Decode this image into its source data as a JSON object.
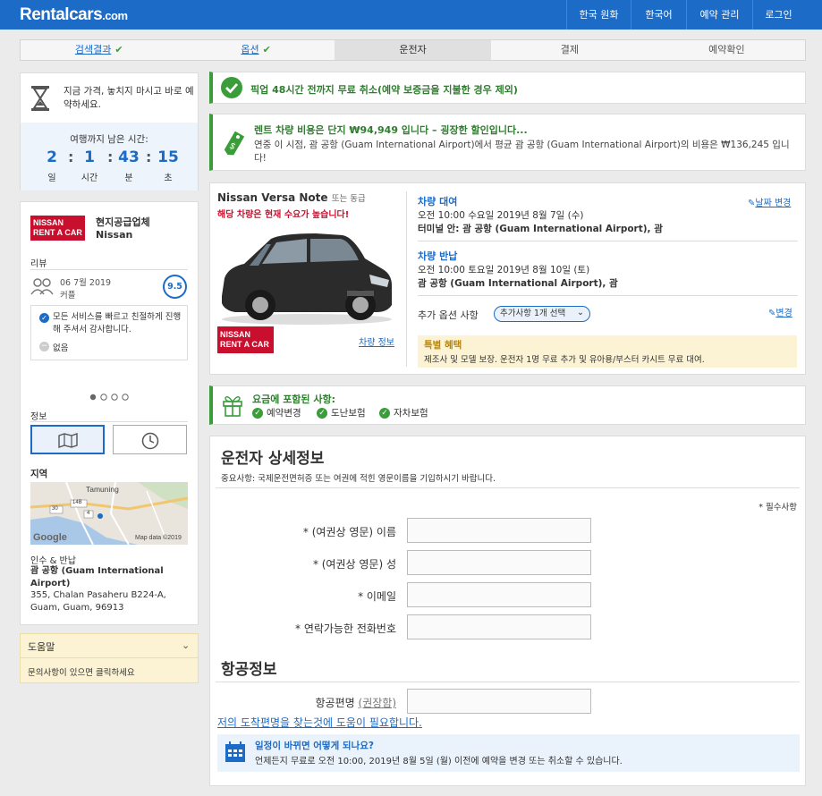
{
  "header": {
    "logo_main": "Rentalcars",
    "logo_suffix": ".com",
    "nav": [
      "한국 원화",
      "한국어",
      "예약 관리",
      "로그인"
    ]
  },
  "steps": [
    {
      "label": "검색결과",
      "state": "done"
    },
    {
      "label": "옵션",
      "state": "done"
    },
    {
      "label": "운전자",
      "state": "active"
    },
    {
      "label": "결제",
      "state": "todo"
    },
    {
      "label": "예약확인",
      "state": "todo"
    }
  ],
  "price_lock": {
    "text": "지금 가격, 놓치지 마시고 바로 예약하세요.",
    "countdown_title": "여행까지 남은 시간:",
    "days": "2",
    "hours": "1",
    "minutes": "43",
    "seconds": "15",
    "days_label": "일",
    "hours_label": "시간",
    "minutes_label": "분",
    "seconds_label": "초"
  },
  "supplier": {
    "logo_line1": "NISSAN",
    "logo_line2": "RENT A CAR",
    "title": "현지공급업체",
    "name": "Nissan",
    "reviews_label": "리뷰",
    "review_date": "06 7월 2019",
    "review_type": "커플",
    "score": "9.5",
    "review_positive": "모든 서비스를 빠르고 친절하게 진행해 주셔서 감사합니다.",
    "review_negative": "없음",
    "info_label": "정보",
    "region_label": "지역",
    "map_place": "Tamuning",
    "map_google": "Google",
    "map_data": "Map data ©2019",
    "map_route1": "30",
    "map_route2": "14B",
    "map_route3": "4",
    "pickup_label": "인수 & 반납",
    "pickup_name": "괌 공항 (Guam International Airport)",
    "address1": "355, Chalan Pasaheru B224-A,",
    "address2": "Guam, Guam, 96913"
  },
  "help": {
    "title": "도움말",
    "text": "문의사항이 있으면 클릭하세요"
  },
  "cancel_banner": "픽업 48시간 전까지 무료 취소(예약 보증금을 지불한 경우 제외)",
  "deal": {
    "title": "렌트 차량 비용은 단지 ₩94,949 입니다 – 굉장한 할인입니다...",
    "text": "연중 이 시점, 괌 공항 (Guam International Airport)에서 평균 괌 공항 (Guam International Airport)의 비용은 ₩136,245 입니다!"
  },
  "car": {
    "name": "Nissan Versa Note",
    "or_similar": "또는 동급",
    "demand": "해당 차량은 현재 수요가 높습니다!",
    "info_link": "차량 정보",
    "pickup_title": "차량 대여",
    "change_dates": "날짜 변경",
    "pickup_time": "오전 10:00 수요일 2019년 8월 7일 (수)",
    "pickup_place": "터미널 안: 괌 공항 (Guam International Airport), 괌",
    "dropoff_title": "차량 반납",
    "dropoff_time": "오전 10:00 토요일 2019년 8월 10일 (토)",
    "dropoff_place": "괌 공항 (Guam International Airport), 괌",
    "extras_label": "추가 옵션 사항",
    "extras_value": "추가사항 1개 선택",
    "edit_link": "변경",
    "special_title": "특별 혜택",
    "special_text": "제조사 및 모델 보장. 운전자 1명 무료 추가 및 유아용/부스터 카시트 무료 대여."
  },
  "included": {
    "title": "요금에 포함된 사항:",
    "items": [
      "예약변경",
      "도난보험",
      "자차보험"
    ]
  },
  "driver": {
    "heading": "운전자 상세정보",
    "note": "중요사항: 국제운전면허증 또는 여권에 적힌 영문이름을 기입하시기 바랍니다.",
    "required": "* 필수사항",
    "first_name": "* (여권상 영문) 이름",
    "last_name": "* (여권상 영문) 성",
    "email": "* 이메일",
    "phone": "* 연락가능한 전화번호"
  },
  "flight": {
    "heading": "항공정보",
    "number_label": "항공편명",
    "recommended": "(권장함)",
    "help_link": "저의 도착편명을 찾는것에 도움이 필요합니다.",
    "change_title": "일정이 바뀌면 어떻게 되나요?",
    "change_text": "언제든지 무료로 오전 10:00, 2019년 8월 5일 (월) 이전에 예약을 변경 또는 취소할 수 있습니다."
  }
}
